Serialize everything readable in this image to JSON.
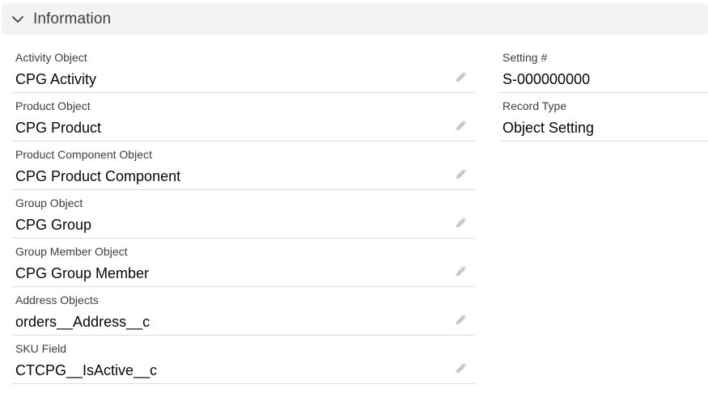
{
  "section": {
    "title": "Information"
  },
  "left_fields": [
    {
      "label": "Activity Object",
      "value": "CPG Activity"
    },
    {
      "label": "Product Object",
      "value": "CPG Product"
    },
    {
      "label": "Product Component Object",
      "value": "CPG Product Component"
    },
    {
      "label": "Group Object",
      "value": "CPG Group"
    },
    {
      "label": "Group Member Object",
      "value": "CPG Group Member"
    },
    {
      "label": "Address Objects",
      "value": "orders__Address__c"
    },
    {
      "label": "SKU Field",
      "value": "CTCPG__IsActive__c"
    }
  ],
  "right_fields": [
    {
      "label": "Setting #",
      "value": "S-000000000"
    },
    {
      "label": "Record Type",
      "value": "Object Setting"
    }
  ],
  "icons": {
    "section_toggle": "chevron-down-icon",
    "edit": "pencil-icon"
  },
  "colors": {
    "header_bg": "#f3f3f3",
    "divider": "#dddbda",
    "label": "#3e3e3c",
    "value": "#080707",
    "edit_icon": "#c9c7c5"
  }
}
